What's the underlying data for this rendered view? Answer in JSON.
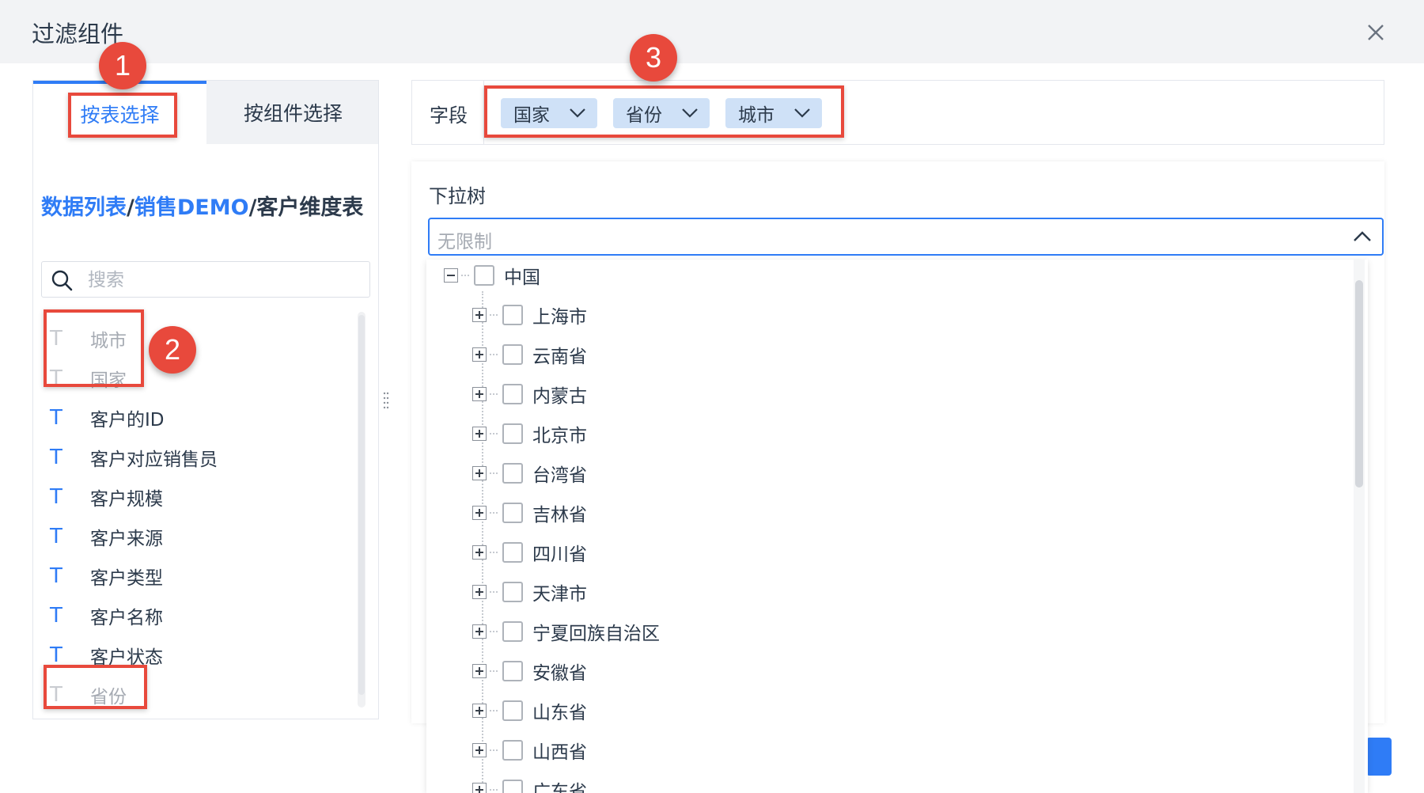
{
  "dialog": {
    "title": "过滤组件"
  },
  "tabs": {
    "by_table": "按表选择",
    "by_component": "按组件选择"
  },
  "breadcrumb": {
    "root": "数据列表",
    "sep1": "/",
    "folder": "销售DEMO",
    "sep2": "/",
    "current": "客户维度表"
  },
  "search": {
    "placeholder": "搜索",
    "value": ""
  },
  "fields": [
    {
      "label": "城市",
      "type_icon": "text-type-icon",
      "used": true
    },
    {
      "label": "国家",
      "type_icon": "text-type-icon",
      "used": true
    },
    {
      "label": "客户的ID",
      "type_icon": "text-type-icon",
      "used": false
    },
    {
      "label": "客户对应销售员",
      "type_icon": "text-type-icon",
      "used": false
    },
    {
      "label": "客户规模",
      "type_icon": "text-type-icon",
      "used": false
    },
    {
      "label": "客户来源",
      "type_icon": "text-type-icon",
      "used": false
    },
    {
      "label": "客户类型",
      "type_icon": "text-type-icon",
      "used": false
    },
    {
      "label": "客户名称",
      "type_icon": "text-type-icon",
      "used": false
    },
    {
      "label": "客户状态",
      "type_icon": "text-type-icon",
      "used": false
    },
    {
      "label": "省份",
      "type_icon": "text-type-icon",
      "used": true
    }
  ],
  "field_type_glyph": "T",
  "field_row": {
    "label": "字段",
    "chips": [
      "国家",
      "省份",
      "城市"
    ]
  },
  "tree": {
    "label": "下拉树",
    "placeholder": "无限制",
    "root": "中国",
    "children": [
      "上海市",
      "云南省",
      "内蒙古",
      "北京市",
      "台湾省",
      "吉林省",
      "四川省",
      "天津市",
      "宁夏回族自治区",
      "安徽省",
      "山东省",
      "山西省",
      "广东省"
    ]
  },
  "annotations": [
    "1",
    "2",
    "3"
  ],
  "colors": {
    "accent": "#2f7cf6",
    "annotation_red": "#e8493c",
    "chip_bg": "#cfe1f7",
    "disabled_text": "#a6abb3"
  }
}
